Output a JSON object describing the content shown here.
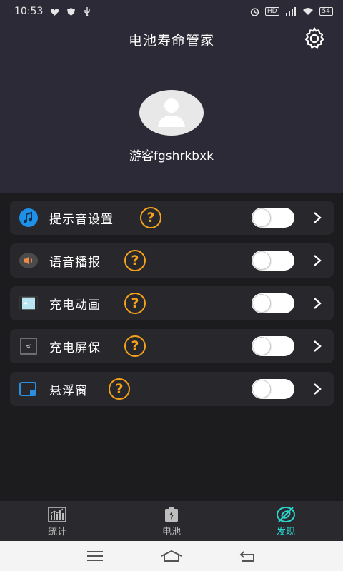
{
  "status_bar": {
    "time": "10:53",
    "right_text": "HD",
    "battery": "54"
  },
  "header": {
    "title": "电池寿命管家",
    "username": "游客fgshrkbxk"
  },
  "settings": [
    {
      "label": "提示音设置",
      "icon": "music-note-icon",
      "enabled": false
    },
    {
      "label": "语音播报",
      "icon": "speaker-icon",
      "enabled": false
    },
    {
      "label": "充电动画",
      "icon": "animation-icon",
      "enabled": false
    },
    {
      "label": "充电屏保",
      "icon": "screensaver-icon",
      "enabled": false
    },
    {
      "label": "悬浮窗",
      "icon": "floating-window-icon",
      "enabled": false
    }
  ],
  "help_glyph": "?",
  "tabs": [
    {
      "label": "统计",
      "icon": "stats-icon",
      "active": false
    },
    {
      "label": "电池",
      "icon": "battery-icon",
      "active": false
    },
    {
      "label": "发现",
      "icon": "discover-icon",
      "active": true
    }
  ],
  "colors": {
    "header_bg": "#2b2a36",
    "page_bg": "#1c1c1e",
    "row_bg": "#27272c",
    "help_accent": "#f4a21b",
    "active_tab": "#2bd9d2"
  }
}
